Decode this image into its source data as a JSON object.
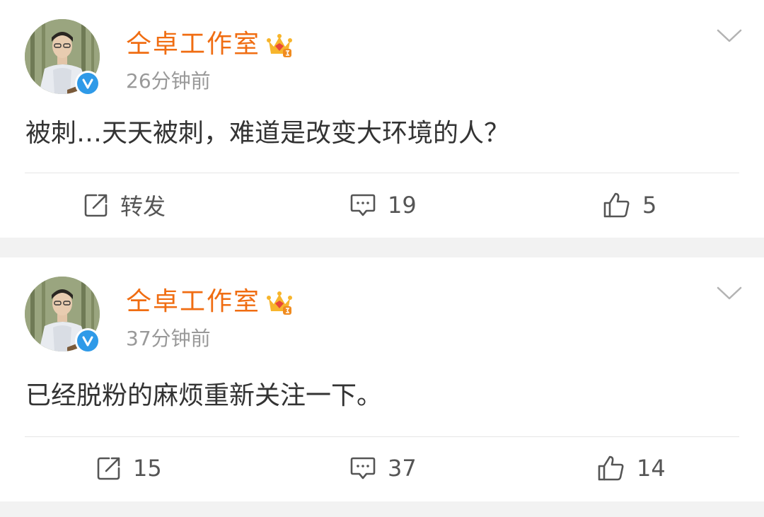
{
  "posts": [
    {
      "username": "仝卓工作室",
      "time": "26分钟前",
      "content": "被刺…天天被刺，难道是改变大环境的人？",
      "actions": {
        "repost": "转发",
        "comment": "19",
        "like": "5"
      }
    },
    {
      "username": "仝卓工作室",
      "time": "37分钟前",
      "content": "已经脱粉的麻烦重新关注一下。",
      "actions": {
        "repost": "15",
        "comment": "37",
        "like": "14"
      }
    }
  ],
  "colors": {
    "username": "#f06d12",
    "verified": "#2f9ae8",
    "muted": "#999999",
    "text": "#333333",
    "background": "#f2f2f2"
  },
  "icons": {
    "verified": "verified-v-icon",
    "member": "crown-icon",
    "menu": "chevron-down-icon",
    "repost": "repost-icon",
    "comment": "comment-icon",
    "like": "thumbs-up-icon"
  }
}
